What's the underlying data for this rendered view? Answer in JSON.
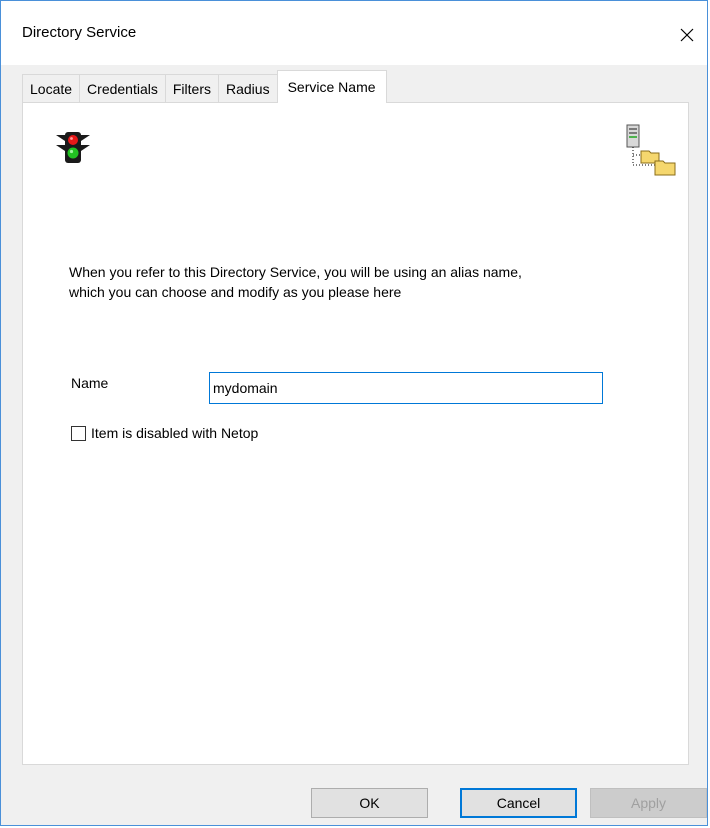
{
  "window": {
    "title": "Directory Service"
  },
  "tabs": [
    {
      "label": "Locate",
      "active": false
    },
    {
      "label": "Credentials",
      "active": false
    },
    {
      "label": "Filters",
      "active": false
    },
    {
      "label": "Radius",
      "active": false
    },
    {
      "label": "Service Name",
      "active": true
    }
  ],
  "panel": {
    "description_line1": "When you refer to this Directory Service, you will be using an alias name,",
    "description_line2": "which you can choose and modify as you please here",
    "name_label": "Name",
    "name_value": "mydomain",
    "disabled_checkbox_label": "Item is disabled with Netop",
    "disabled_checked": false,
    "icons": [
      "traffic-light-icon",
      "directory-tree-icon"
    ]
  },
  "buttons": {
    "ok": "OK",
    "cancel": "Cancel",
    "apply": "Apply"
  },
  "colors": {
    "accent": "#0078d7",
    "window_border": "#4a90d9"
  }
}
